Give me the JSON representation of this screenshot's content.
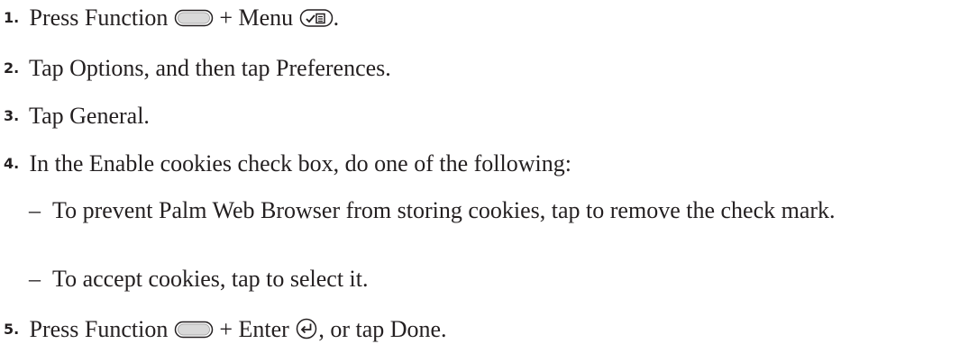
{
  "steps": [
    {
      "number": "1.",
      "parts": {
        "a": "Press Function",
        "b": "+ Menu",
        "c": "."
      },
      "icons": [
        "function-button",
        "menu-button"
      ]
    },
    {
      "number": "2.",
      "text": "Tap Options, and then tap Preferences."
    },
    {
      "number": "3.",
      "text": "Tap General."
    },
    {
      "number": "4.",
      "text": "In the Enable cookies check box, do one of the following:",
      "substeps": [
        {
          "marker": "–",
          "text": "To prevent Palm Web Browser from storing cookies, tap to remove the check mark."
        },
        {
          "marker": "–",
          "text": "To accept cookies, tap to select it."
        }
      ]
    },
    {
      "number": "5.",
      "parts": {
        "a": "Press Function",
        "b": "+ Enter",
        "c": ", or tap Done."
      },
      "icons": [
        "function-button",
        "enter-button"
      ]
    }
  ]
}
